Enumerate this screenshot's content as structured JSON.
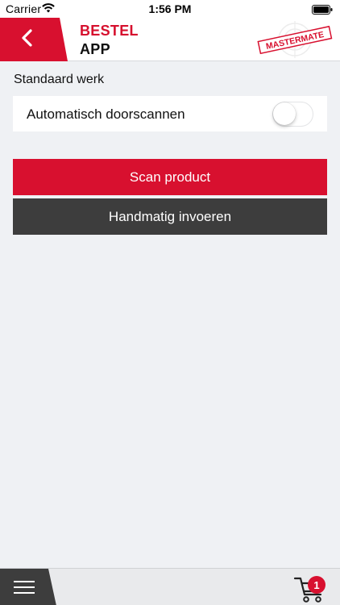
{
  "status_bar": {
    "carrier": "Carrier",
    "time": "1:56 PM"
  },
  "header": {
    "title_line1": "BESTEL",
    "title_line2": "APP",
    "logo_text": "MASTERMATE",
    "back_icon": "chevron-left-icon"
  },
  "section": {
    "label": "Standaard werk",
    "toggle_label": "Automatisch doorscannen",
    "toggle_on": false
  },
  "buttons": {
    "scan_label": "Scan product",
    "manual_label": "Handmatig invoeren"
  },
  "bottom_bar": {
    "menu_icon": "hamburger-menu-icon",
    "cart_icon": "shopping-cart-icon",
    "cart_count": "1"
  },
  "colors": {
    "brand_red": "#d8102f",
    "dark_button": "#3d3d3d",
    "background": "#eff1f4"
  }
}
